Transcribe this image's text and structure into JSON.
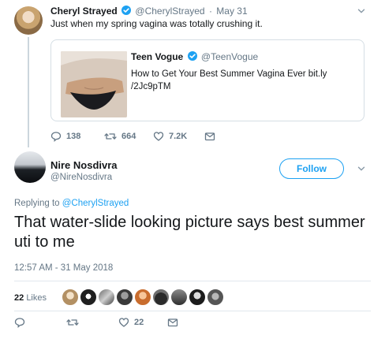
{
  "parent_tweet": {
    "author_name": "Cheryl Strayed",
    "author_handle": "@CherylStrayed",
    "separator": "·",
    "date": "May 31",
    "text": "Just when my spring vagina was totally crushing it.",
    "quoted": {
      "author_name": "Teen Vogue",
      "author_handle": "@TeenVogue",
      "text": "How to Get Your Best Summer Vagina Ever bit.ly /2Jc9pTM"
    },
    "actions": {
      "replies": "138",
      "retweets": "664",
      "likes": "7.2K"
    }
  },
  "reply_tweet": {
    "author_name": "Nire Nosdivra",
    "author_handle": "@NireNosdivra",
    "follow_label": "Follow",
    "replying_prefix": "Replying to",
    "replying_to": "@CherylStrayed",
    "text": "That water-slide looking picture says best summer uti to me",
    "timestamp": "12:57 AM - 31 May 2018",
    "likes_count": "22",
    "likes_label": "Likes",
    "actions": {
      "likes": "22"
    }
  },
  "colors": {
    "accent": "#1da1f2",
    "secondary_text": "#657786",
    "border": "#e1e8ed"
  },
  "icons": [
    "verified-badge-icon",
    "chevron-down-icon",
    "reply-icon",
    "retweet-icon",
    "heart-icon",
    "direct-message-icon"
  ]
}
